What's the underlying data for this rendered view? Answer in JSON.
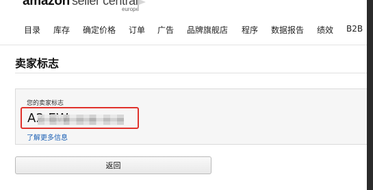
{
  "header": {
    "logo_amazon": "amazon",
    "logo_seller": "seller central",
    "logo_region": "europe",
    "nav": [
      {
        "label": "目录"
      },
      {
        "label": "库存"
      },
      {
        "label": "确定价格"
      },
      {
        "label": "订单"
      },
      {
        "label": "广告"
      },
      {
        "label": "品牌旗舰店"
      },
      {
        "label": "程序"
      },
      {
        "label": "数据报告"
      },
      {
        "label": "绩效"
      },
      {
        "label": "B2B"
      }
    ]
  },
  "page": {
    "title": "卖家标志"
  },
  "token": {
    "label": "您的卖家标志",
    "value": "A2                    EW",
    "learn_more": "了解更多信息"
  },
  "actions": {
    "back_label": "返回"
  },
  "colors": {
    "highlight_border": "#e0312b",
    "link": "#1a5fb4"
  },
  "icons": {
    "flag": "flag-icon"
  }
}
